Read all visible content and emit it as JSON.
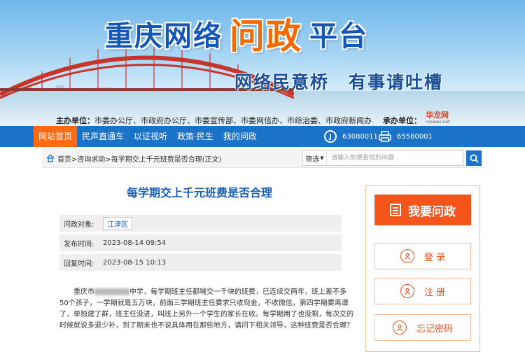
{
  "header": {
    "title_part1": "重庆网络",
    "title_part2": "问政",
    "title_part3": "平台",
    "slogan_1": "网络民意桥",
    "slogan_2": "有事请吐槽",
    "sponsor_label": "主办单位：",
    "sponsor_value": "市委办公厅、市政府办公厅、市委宣传部、市委网信办、市综治委、市政府新闻办",
    "host_label": "承办单位：",
    "host_logo": "华龙网",
    "host_logo_sub": "cqnews.net"
  },
  "nav": {
    "items": [
      "网站首页",
      "民声直通车",
      "以证视听",
      "政策·民生",
      "我的问政"
    ],
    "phone": "63080011",
    "fax": "65580001"
  },
  "breadcrumb": {
    "home": "首页",
    "rest": ">咨询求助>每学期交上千元班费是否合理(正文)"
  },
  "search": {
    "filter_label": "筛选",
    "placeholder": "请输入你想查找的问题"
  },
  "article": {
    "title": "每学期交上千元班费是否合理",
    "target_label": "问政对象:",
    "target_value": "江津区",
    "publish_label": "发布时间:",
    "publish_time": "2023-08-14 09:54",
    "reply_label": "回复时间:",
    "reply_time": "2023-08-15 10:13",
    "body_prefix": "重庆市",
    "body_rest": "中学，每学期班主任都喊交一千块的班费，已连续交两年，班上差不多50个孩子，一学期就是五万块，前面三学期班主任要求只收现金，不收微信，第四学期要离谱了，单独建了群，班主任没进，叫班上另外一个学生的家长在收。每学期用了也没剩，每次交的时候就说多退少补，到了期末也不说具体用在那些地方，请问下相关领导，这种班费是否合理？"
  },
  "side": {
    "main_button": "我要问政",
    "login": "登 录",
    "register": "注 册",
    "forgot": "忘记密码"
  },
  "colors": {
    "nav_blue": "#1a73c8",
    "accent_orange": "#f5551a",
    "title_blue": "#1a5fb4"
  }
}
